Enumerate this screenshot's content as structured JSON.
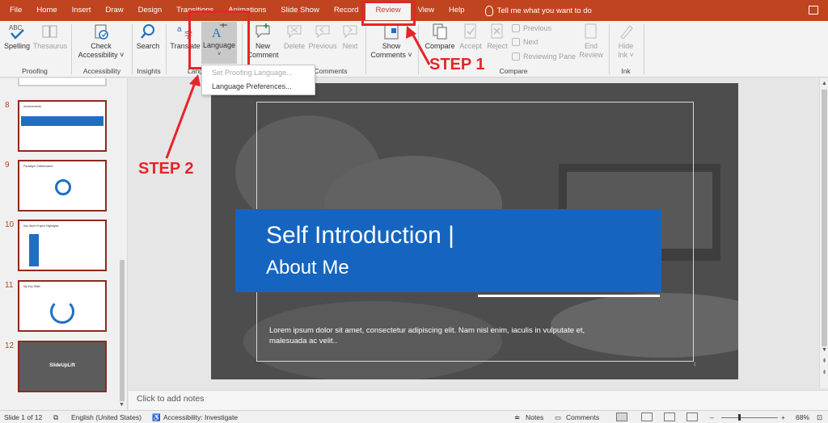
{
  "menu": {
    "tabs": [
      "File",
      "Home",
      "Insert",
      "Draw",
      "Design",
      "Transitions",
      "Animations",
      "Slide Show",
      "Record",
      "Review",
      "View",
      "Help"
    ],
    "active_tab": "Review",
    "tellme": "Tell me what you want to do"
  },
  "ribbon": {
    "spelling": "Spelling",
    "thesaurus": "Thesaurus",
    "group_proofing": "Proofing",
    "check_access_1": "Check",
    "check_access_2": "Accessibility ˅",
    "group_accessibility": "Accessibility",
    "search": "Search",
    "group_insights": "Insights",
    "translate": "Translate",
    "language": "Language",
    "group_language": "Lang",
    "new_comment_1": "New",
    "new_comment_2": "Comment",
    "delete": "Delete",
    "previous": "Previous",
    "next": "Next",
    "group_comments": "Comments",
    "show_comments_1": "Show",
    "show_comments_2": "Comments ˅",
    "compare": "Compare",
    "accept": "Accept",
    "reject": "Reject",
    "prev_small": "Previous",
    "next_small": "Next",
    "reviewing_pane": "Reviewing Pane",
    "end_review_1": "End",
    "end_review_2": "Review",
    "group_compare": "Compare",
    "hide_ink_1": "Hide",
    "hide_ink_2": "Ink ˅",
    "group_ink": "Ink"
  },
  "dropdown": {
    "item1": "Set Proofing Language...",
    "item2": "Language Preferences..."
  },
  "thumbnails": [
    {
      "num": "8",
      "title": "Achievements"
    },
    {
      "num": "9",
      "title": "Paradigm Collaboration"
    },
    {
      "num": "10",
      "title": "Key Work Project Highlights"
    },
    {
      "num": "11",
      "title": "My Key Skills"
    },
    {
      "num": "12",
      "title": "SlideUpLift"
    }
  ],
  "slide": {
    "title_line1": "Self Introduction |",
    "title_line2": "About Me",
    "body": "Lorem ipsum dolor sit amet, consectetur adipiscing elit. Nam nisl enim, iaculis in vulputate et, malesuada ac velit..",
    "slide_number": "1"
  },
  "notes_placeholder": "Click to add notes",
  "status": {
    "slide_of": "Slide 1 of 12",
    "language": "English (United States)",
    "accessibility": "Accessibility: Investigate",
    "notes": "Notes",
    "comments": "Comments",
    "zoom": "68%"
  },
  "annotations": {
    "step1": "STEP 1",
    "step2": "STEP 2"
  },
  "colors": {
    "brand": "#c0441f",
    "annotation_red": "#e5252a",
    "title_band": "#1565c0"
  }
}
